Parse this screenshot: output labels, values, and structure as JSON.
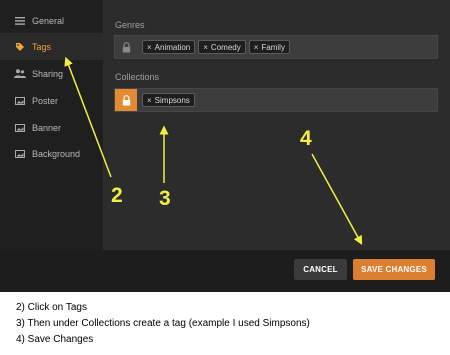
{
  "sidebar": {
    "items": [
      {
        "label": "General",
        "icon": "list-icon"
      },
      {
        "label": "Tags",
        "icon": "tag-icon"
      },
      {
        "label": "Sharing",
        "icon": "users-icon"
      },
      {
        "label": "Poster",
        "icon": "image-icon"
      },
      {
        "label": "Banner",
        "icon": "image-icon"
      },
      {
        "label": "Background",
        "icon": "image-icon"
      }
    ],
    "active_item": "Tags"
  },
  "genres": {
    "label": "Genres",
    "tags": [
      "Animation",
      "Comedy",
      "Family"
    ],
    "remove_symbol": "×"
  },
  "collections": {
    "label": "Collections",
    "tags": [
      "Simpsons"
    ],
    "remove_symbol": "×"
  },
  "footer": {
    "cancel_label": "CANCEL",
    "save_label": "SAVE CHANGES"
  },
  "annotations": {
    "numbers": [
      "2",
      "3",
      "4"
    ],
    "color": "#f1ef44"
  },
  "instructions": {
    "lines": [
      "2) Click on Tags",
      "3) Then under Collections create a tag (example I used Simpsons)",
      "4) Save Changes"
    ]
  },
  "colors": {
    "accent": "#e38b33",
    "active_text": "#f0a53a",
    "background": "#2a2a2a"
  }
}
